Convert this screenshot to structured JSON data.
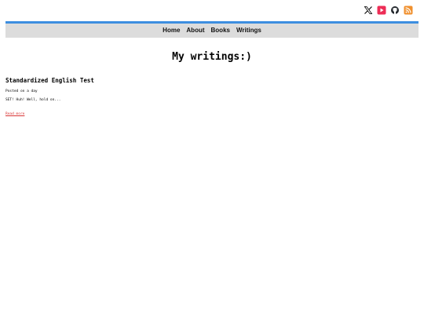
{
  "header": {
    "socials": [
      {
        "name": "x-twitter",
        "icon": "x-icon",
        "color": "#000000"
      },
      {
        "name": "youtube",
        "icon": "youtube-icon",
        "color": "#ed2d56"
      },
      {
        "name": "github",
        "icon": "github-icon",
        "color": "#24292e"
      },
      {
        "name": "rss",
        "icon": "rss-icon",
        "color": "#f0902e"
      }
    ]
  },
  "nav": {
    "accent_color": "#3d8ee0",
    "background": "#dcdcdc",
    "items": [
      {
        "label": "Home"
      },
      {
        "label": "About"
      },
      {
        "label": "Books"
      },
      {
        "label": "Writings"
      }
    ]
  },
  "main": {
    "title": "My writings:)",
    "posts": [
      {
        "title": "Standardized English Test",
        "date": "Posted on a day",
        "excerpt": "SET! Huh! Well, hold on...",
        "read_more": "Read more",
        "read_more_color": "#d93636"
      }
    ]
  }
}
